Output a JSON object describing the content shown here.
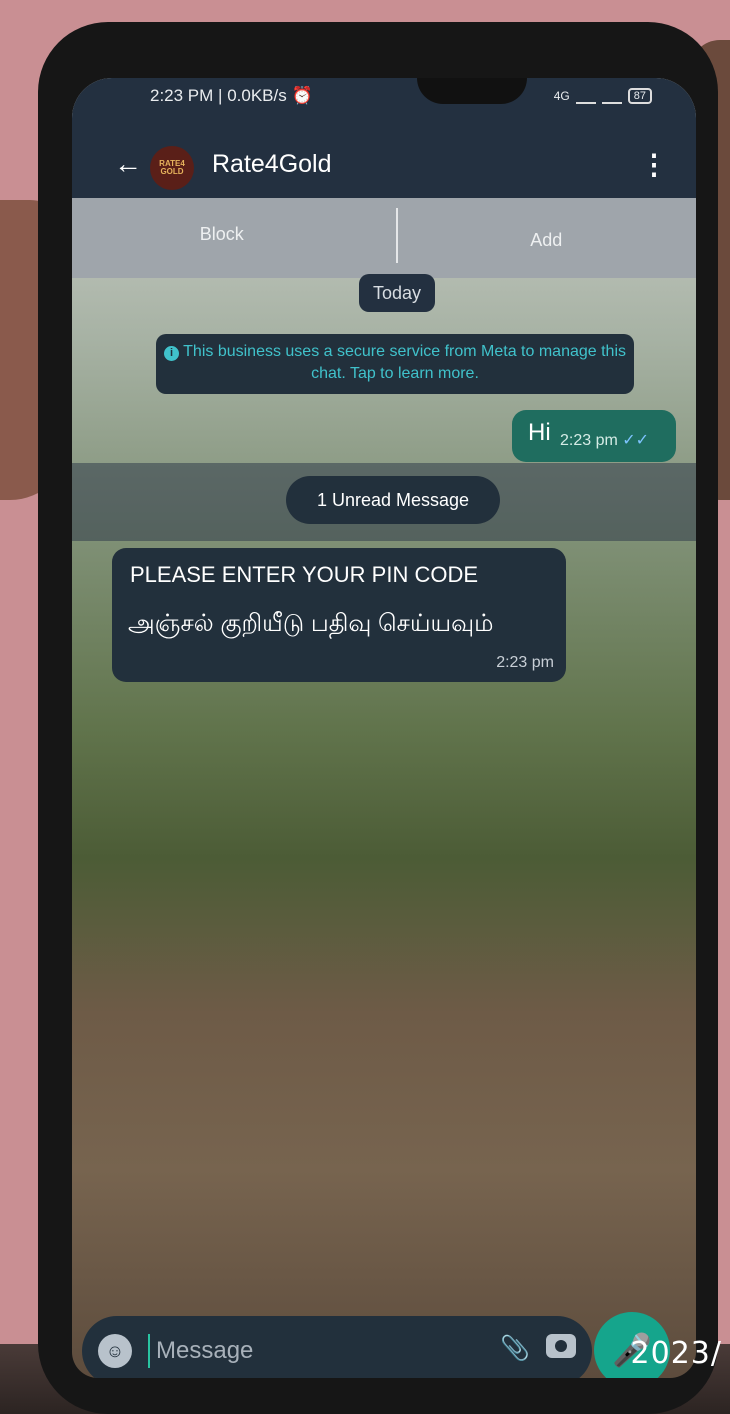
{
  "status_bar": {
    "time": "2:23 PM",
    "speed": "0.0KB/s",
    "alarm_icon": "alarm-icon",
    "network": "4G",
    "battery": "87"
  },
  "header": {
    "title": "Rate4Gold",
    "avatar_text": "RATE4 GOLD",
    "back_icon": "arrow-left-icon",
    "menu_icon": "three-dots-vertical-icon"
  },
  "actions": {
    "block": "Block",
    "add": "Add"
  },
  "chat": {
    "date_label": "Today",
    "meta_notice": "This business uses a secure service from Meta to manage this chat. Tap to learn more.",
    "unread_label": "1 Unread Message",
    "messages": [
      {
        "direction": "outgoing",
        "text": "Hi",
        "time": "2:23 pm",
        "status_icon": "double-check-icon"
      },
      {
        "direction": "incoming",
        "line1": "PLEASE ENTER YOUR PIN CODE",
        "line2": "அஞ்சல் குறியீடு பதிவு செய்யவும்",
        "time": "2:23 pm"
      }
    ]
  },
  "composer": {
    "placeholder": "Message",
    "emoji_icon": "emoji-icon",
    "attach_icon": "paperclip-icon",
    "camera_icon": "camera-icon",
    "mic_icon": "mic-icon"
  },
  "photo_stamp": "2023/",
  "colors": {
    "bar": "#233040",
    "bubble_out": "#1f6d5f",
    "bubble_in": "#22303c",
    "accent": "#15a58c"
  }
}
